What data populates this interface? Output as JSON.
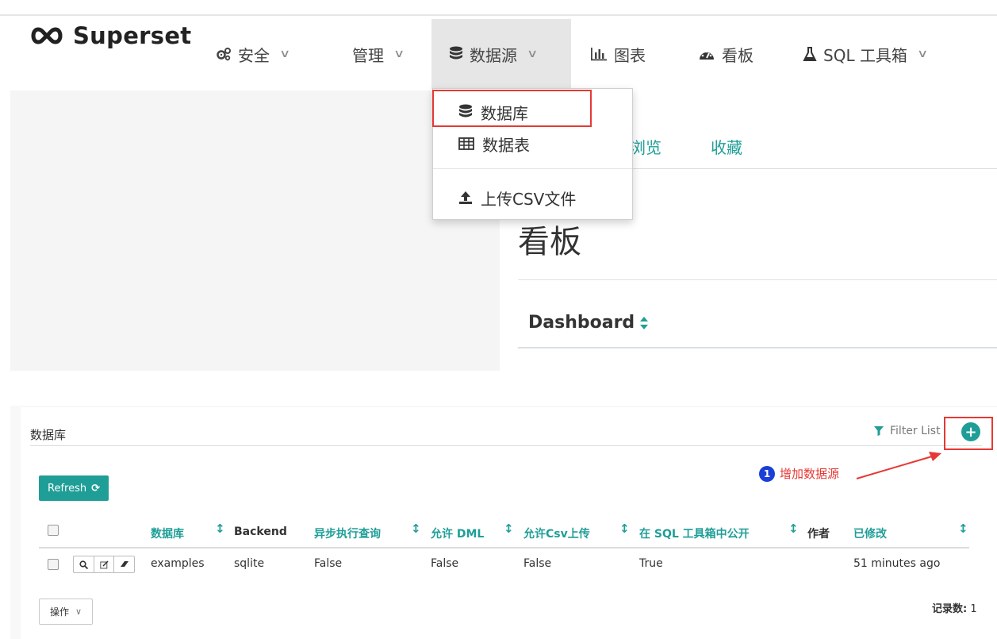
{
  "navbar": {
    "brand": "Superset",
    "items": [
      {
        "label": "安全",
        "icon": "cogs-icon"
      },
      {
        "label": "管理",
        "icon": ""
      },
      {
        "label": "数据源",
        "icon": "database-icon"
      },
      {
        "label": "图表",
        "icon": "bar-chart-icon"
      },
      {
        "label": "看板",
        "icon": "dashboard-gauge-icon"
      },
      {
        "label": "SQL 工具箱",
        "icon": "flask-icon"
      }
    ]
  },
  "dropdown": {
    "items": [
      {
        "label": "数据库",
        "icon": "database-icon"
      },
      {
        "label": "数据表",
        "icon": "table-icon"
      },
      {
        "label": "上传CSV文件",
        "icon": "upload-icon"
      }
    ]
  },
  "background_page": {
    "tabs": [
      "浏览",
      "收藏"
    ],
    "title": "看板",
    "column_header": "Dashboard"
  },
  "panel": {
    "title": "数据库",
    "filter_list": "Filter List",
    "add_button": "+",
    "annotation": {
      "number": "1",
      "text": "增加数据源"
    },
    "refresh_label": "Refresh",
    "columns": [
      "数据库",
      "Backend",
      "异步执行查询",
      "允许 DML",
      "允许Csv上传",
      "在 SQL 工具箱中公开",
      "作者",
      "已修改"
    ],
    "rows": [
      {
        "database": "examples",
        "backend": "sqlite",
        "async": "False",
        "allow_dml": "False",
        "allow_csv": "False",
        "expose_sql": "True",
        "author": "",
        "modified": "51 minutes ago"
      }
    ],
    "actions_label": "操作",
    "record_count_label": "记录数:",
    "record_count_value": "1"
  },
  "colors": {
    "accent": "#1f9e97",
    "highlight": "#e53935",
    "annotation_badge": "#1a3fd6"
  }
}
